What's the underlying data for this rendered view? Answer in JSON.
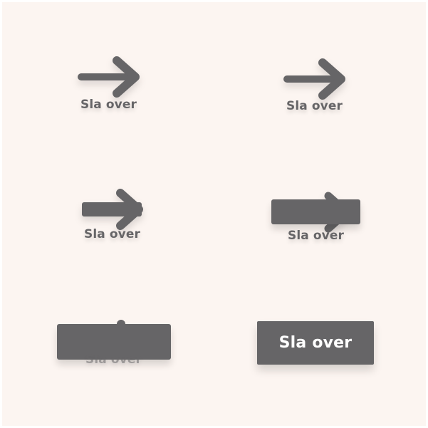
{
  "skip_label": "Sla over",
  "colors": {
    "background": "#fcf5f1",
    "element": "#666567",
    "button_text": "#ffffff"
  },
  "icons": {
    "arrow": "arrow-right-icon"
  },
  "frames": [
    {
      "state": "arrow-with-label"
    },
    {
      "state": "arrow-with-label"
    },
    {
      "state": "arrow-stem-thickening"
    },
    {
      "state": "arrow-morphing-into-bar"
    },
    {
      "state": "bar-with-fading-label"
    },
    {
      "state": "skip-button"
    }
  ]
}
